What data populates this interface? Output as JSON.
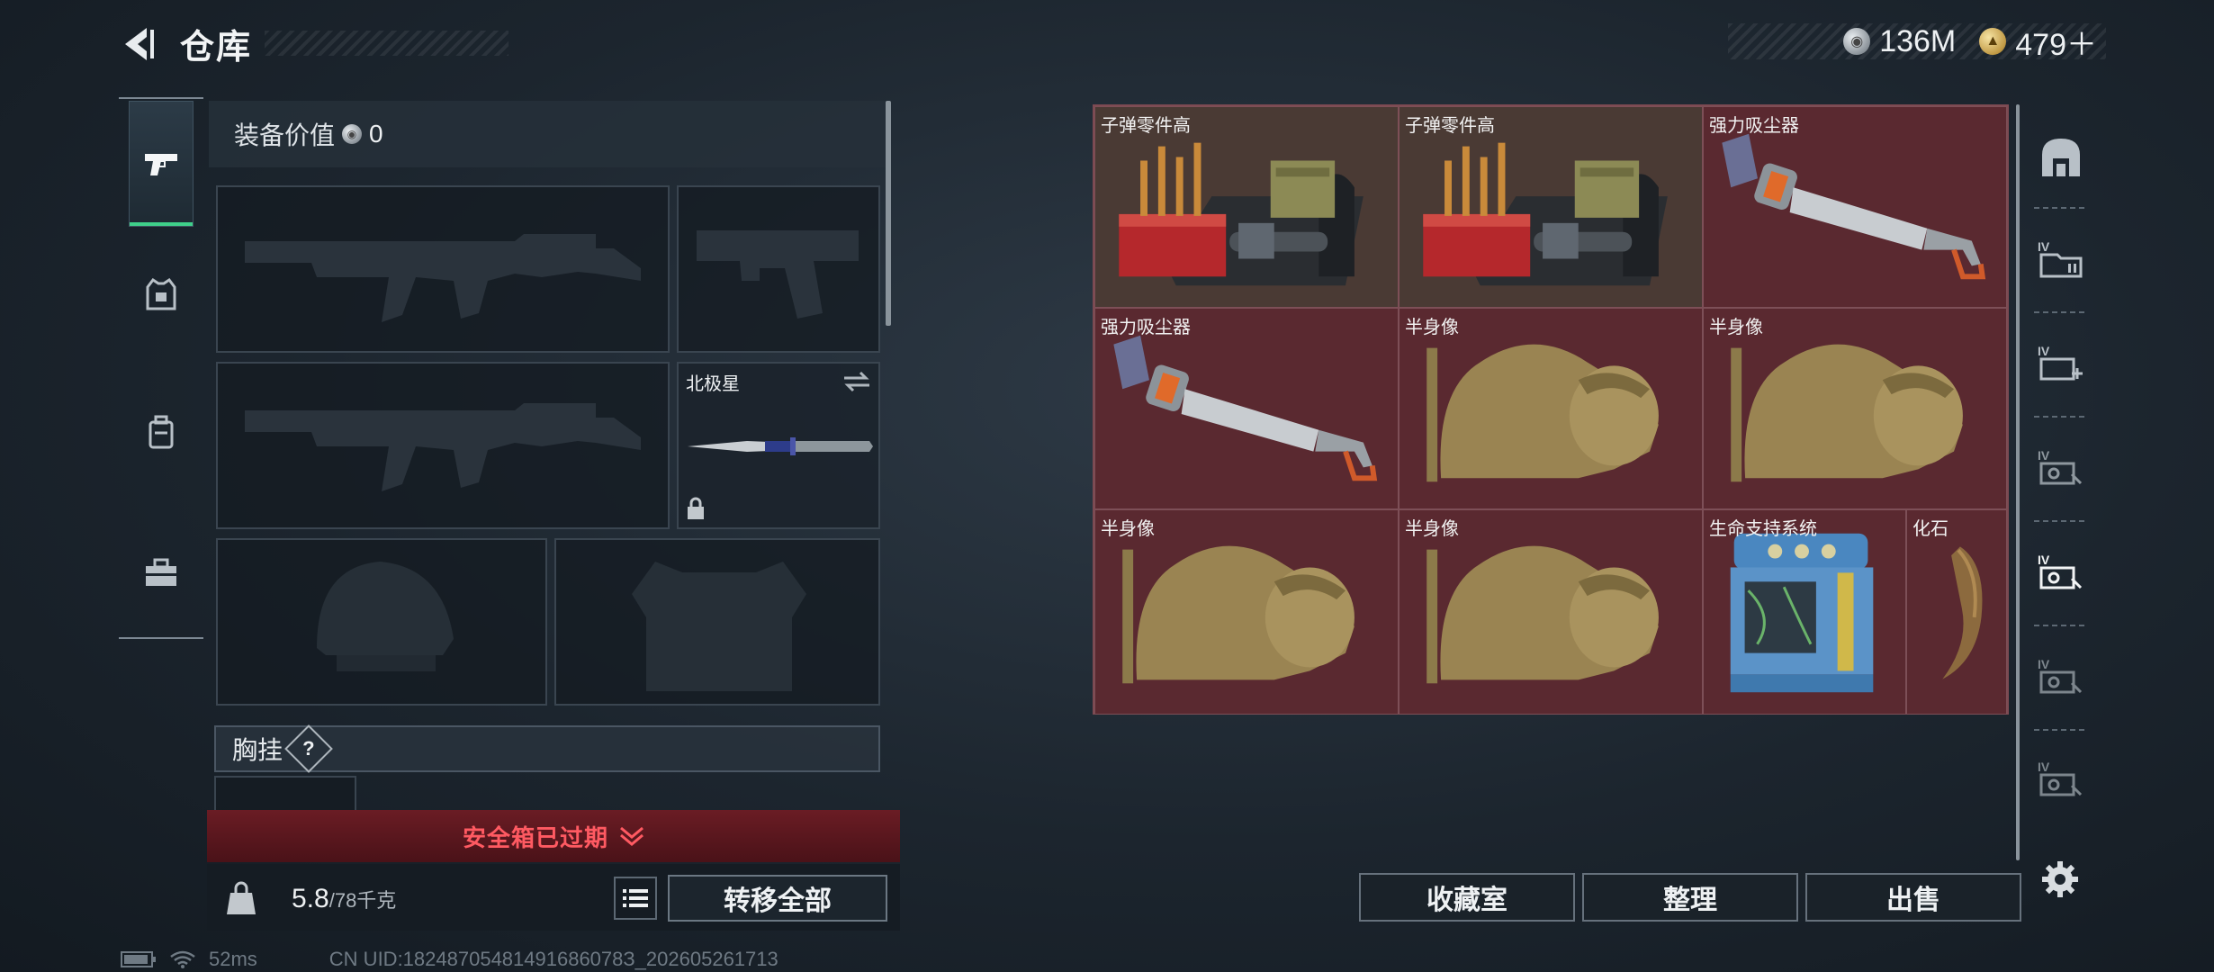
{
  "header": {
    "title": "仓库",
    "currency": [
      {
        "icon": "silver-coin-icon",
        "amount": "136M"
      },
      {
        "icon": "gold-coin-icon",
        "amount": "479＋"
      }
    ]
  },
  "left_rail": {
    "items": [
      {
        "name": "weapons",
        "icon": "pistol-icon",
        "active": true
      },
      {
        "name": "armor",
        "icon": "vest-icon"
      },
      {
        "name": "backpack",
        "icon": "backpack-icon"
      },
      {
        "name": "supplies",
        "icon": "toolbox-icon"
      }
    ]
  },
  "equipment": {
    "value_label": "装备价值",
    "value": "0",
    "melee_name": "北极星",
    "chest_label": "胸挂",
    "chest_help": "?",
    "safebox_text": "安全箱已过期",
    "weight_current": "5.8",
    "weight_max": "/78千克",
    "transfer_all": "转移全部"
  },
  "storage": {
    "items": [
      {
        "name": "子弹零件高",
        "kind": "ammo-parts",
        "bg": "tan"
      },
      {
        "name": "子弹零件高",
        "kind": "ammo-parts",
        "bg": "tan"
      },
      {
        "name": "强力吸尘器",
        "kind": "vacuum",
        "bg": "red"
      },
      {
        "name": "强力吸尘器",
        "kind": "vacuum",
        "bg": "red"
      },
      {
        "name": "半身像",
        "kind": "bust",
        "bg": "red"
      },
      {
        "name": "半身像",
        "kind": "bust",
        "bg": "red"
      },
      {
        "name": "半身像",
        "kind": "bust",
        "bg": "red"
      },
      {
        "name": "半身像",
        "kind": "bust",
        "bg": "red"
      },
      {
        "name": "生命支持系统",
        "kind": "life-support",
        "bg": "red"
      },
      {
        "name": "化石",
        "kind": "fossil",
        "bg": "red"
      }
    ],
    "buttons": {
      "collection": "收藏室",
      "sort": "整理",
      "sell": "出售"
    }
  },
  "right_rail": {
    "items": [
      "vault-icon",
      "case-iv-icon",
      "case-iv-add-icon",
      "case-iv-key-icon",
      "case-iv-selected-icon",
      "case-iv-key-icon",
      "case-iv-key-icon"
    ]
  },
  "status": {
    "ping": "52ms",
    "uid": "CN UID:18248705481491686078З_202605261713"
  },
  "colors": {
    "accent_green": "#3fd08a",
    "alert_red": "#ff5a62",
    "grid_red": "#5a2930"
  }
}
